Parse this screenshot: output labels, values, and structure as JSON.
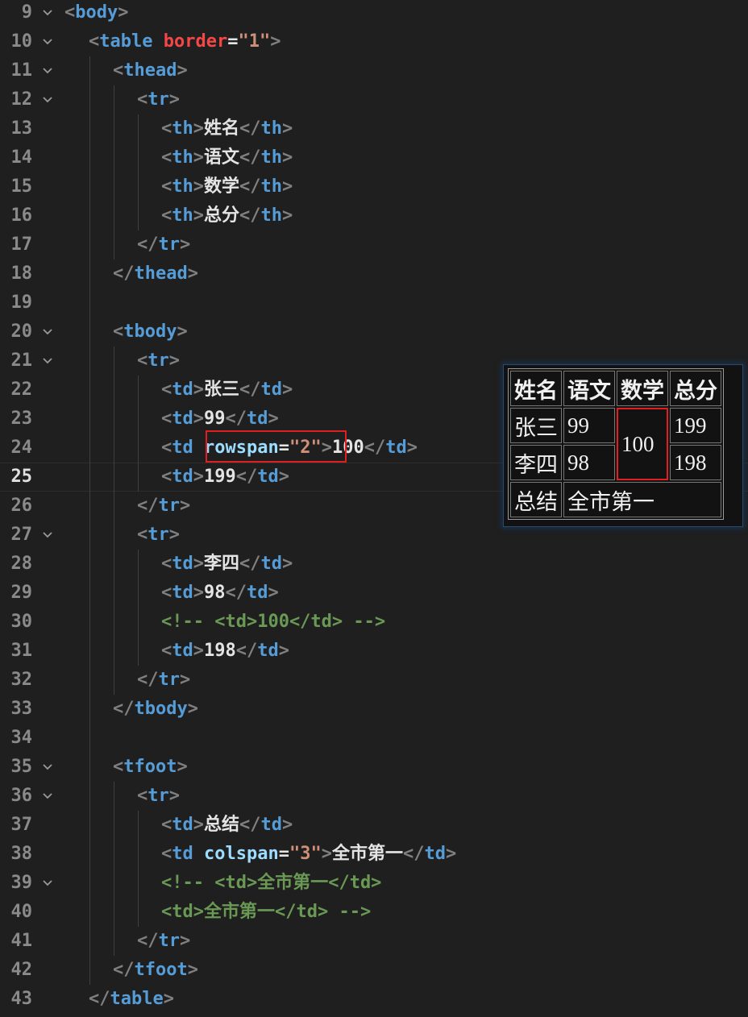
{
  "editor": {
    "lines": [
      {
        "n": "9",
        "fold": true,
        "indent": 0,
        "segs": [
          [
            "br",
            "<"
          ],
          [
            "tag",
            "body"
          ],
          [
            "br",
            ">"
          ]
        ]
      },
      {
        "n": "10",
        "fold": true,
        "indent": 1,
        "segs": [
          [
            "br",
            "<"
          ],
          [
            "tag",
            "table"
          ],
          [
            "txt",
            " "
          ],
          [
            "attrb",
            "border"
          ],
          [
            "txt",
            "="
          ],
          [
            "str",
            "\"1\""
          ],
          [
            "br",
            ">"
          ]
        ]
      },
      {
        "n": "11",
        "fold": true,
        "indent": 2,
        "segs": [
          [
            "br",
            "<"
          ],
          [
            "tag",
            "thead"
          ],
          [
            "br",
            ">"
          ]
        ]
      },
      {
        "n": "12",
        "fold": true,
        "indent": 3,
        "segs": [
          [
            "br",
            "<"
          ],
          [
            "tag",
            "tr"
          ],
          [
            "br",
            ">"
          ]
        ]
      },
      {
        "n": "13",
        "fold": false,
        "indent": 4,
        "segs": [
          [
            "br",
            "<"
          ],
          [
            "tag",
            "th"
          ],
          [
            "br",
            ">"
          ],
          [
            "txt",
            "姓名"
          ],
          [
            "br",
            "</"
          ],
          [
            "tag",
            "th"
          ],
          [
            "br",
            ">"
          ]
        ]
      },
      {
        "n": "14",
        "fold": false,
        "indent": 4,
        "segs": [
          [
            "br",
            "<"
          ],
          [
            "tag",
            "th"
          ],
          [
            "br",
            ">"
          ],
          [
            "txt",
            "语文"
          ],
          [
            "br",
            "</"
          ],
          [
            "tag",
            "th"
          ],
          [
            "br",
            ">"
          ]
        ]
      },
      {
        "n": "15",
        "fold": false,
        "indent": 4,
        "segs": [
          [
            "br",
            "<"
          ],
          [
            "tag",
            "th"
          ],
          [
            "br",
            ">"
          ],
          [
            "txt",
            "数学"
          ],
          [
            "br",
            "</"
          ],
          [
            "tag",
            "th"
          ],
          [
            "br",
            ">"
          ]
        ]
      },
      {
        "n": "16",
        "fold": false,
        "indent": 4,
        "segs": [
          [
            "br",
            "<"
          ],
          [
            "tag",
            "th"
          ],
          [
            "br",
            ">"
          ],
          [
            "txt",
            "总分"
          ],
          [
            "br",
            "</"
          ],
          [
            "tag",
            "th"
          ],
          [
            "br",
            ">"
          ]
        ]
      },
      {
        "n": "17",
        "fold": false,
        "indent": 3,
        "segs": [
          [
            "br",
            "</"
          ],
          [
            "tag",
            "tr"
          ],
          [
            "br",
            ">"
          ]
        ]
      },
      {
        "n": "18",
        "fold": false,
        "indent": 2,
        "segs": [
          [
            "br",
            "</"
          ],
          [
            "tag",
            "thead"
          ],
          [
            "br",
            ">"
          ]
        ]
      },
      {
        "n": "19",
        "fold": false,
        "indent": 2,
        "segs": []
      },
      {
        "n": "20",
        "fold": true,
        "indent": 2,
        "segs": [
          [
            "br",
            "<"
          ],
          [
            "tag",
            "tbody"
          ],
          [
            "br",
            ">"
          ]
        ]
      },
      {
        "n": "21",
        "fold": true,
        "indent": 3,
        "segs": [
          [
            "br",
            "<"
          ],
          [
            "tag",
            "tr"
          ],
          [
            "br",
            ">"
          ]
        ]
      },
      {
        "n": "22",
        "fold": false,
        "indent": 4,
        "segs": [
          [
            "br",
            "<"
          ],
          [
            "tag",
            "td"
          ],
          [
            "br",
            ">"
          ],
          [
            "txt",
            "张三"
          ],
          [
            "br",
            "</"
          ],
          [
            "tag",
            "td"
          ],
          [
            "br",
            ">"
          ]
        ]
      },
      {
        "n": "23",
        "fold": false,
        "indent": 4,
        "segs": [
          [
            "br",
            "<"
          ],
          [
            "tag",
            "td"
          ],
          [
            "br",
            ">"
          ],
          [
            "txt",
            "99"
          ],
          [
            "br",
            "</"
          ],
          [
            "tag",
            "td"
          ],
          [
            "br",
            ">"
          ]
        ]
      },
      {
        "n": "24",
        "fold": false,
        "indent": 4,
        "segs": [
          [
            "br",
            "<"
          ],
          [
            "tag",
            "td"
          ],
          [
            "txt",
            " "
          ],
          [
            "attr",
            "rowspan"
          ],
          [
            "txt",
            "="
          ],
          [
            "str",
            "\"2\""
          ],
          [
            "br",
            ">"
          ],
          [
            "txt",
            "100"
          ],
          [
            "br",
            "</"
          ],
          [
            "tag",
            "td"
          ],
          [
            "br",
            ">"
          ]
        ]
      },
      {
        "n": "25",
        "fold": false,
        "indent": 4,
        "active": true,
        "segs": [
          [
            "br",
            "<"
          ],
          [
            "tag",
            "td"
          ],
          [
            "br",
            ">"
          ],
          [
            "txt",
            "199"
          ],
          [
            "br",
            "</"
          ],
          [
            "tag",
            "td"
          ],
          [
            "br",
            ">"
          ]
        ]
      },
      {
        "n": "26",
        "fold": false,
        "indent": 3,
        "segs": [
          [
            "br",
            "</"
          ],
          [
            "tag",
            "tr"
          ],
          [
            "br",
            ">"
          ]
        ]
      },
      {
        "n": "27",
        "fold": true,
        "indent": 3,
        "segs": [
          [
            "br",
            "<"
          ],
          [
            "tag",
            "tr"
          ],
          [
            "br",
            ">"
          ]
        ]
      },
      {
        "n": "28",
        "fold": false,
        "indent": 4,
        "segs": [
          [
            "br",
            "<"
          ],
          [
            "tag",
            "td"
          ],
          [
            "br",
            ">"
          ],
          [
            "txt",
            "李四"
          ],
          [
            "br",
            "</"
          ],
          [
            "tag",
            "td"
          ],
          [
            "br",
            ">"
          ]
        ]
      },
      {
        "n": "29",
        "fold": false,
        "indent": 4,
        "segs": [
          [
            "br",
            "<"
          ],
          [
            "tag",
            "td"
          ],
          [
            "br",
            ">"
          ],
          [
            "txt",
            "98"
          ],
          [
            "br",
            "</"
          ],
          [
            "tag",
            "td"
          ],
          [
            "br",
            ">"
          ]
        ]
      },
      {
        "n": "30",
        "fold": false,
        "indent": 4,
        "segs": [
          [
            "com",
            "<!-- <td>100</td> -->"
          ]
        ]
      },
      {
        "n": "31",
        "fold": false,
        "indent": 4,
        "segs": [
          [
            "br",
            "<"
          ],
          [
            "tag",
            "td"
          ],
          [
            "br",
            ">"
          ],
          [
            "txt",
            "198"
          ],
          [
            "br",
            "</"
          ],
          [
            "tag",
            "td"
          ],
          [
            "br",
            ">"
          ]
        ]
      },
      {
        "n": "32",
        "fold": false,
        "indent": 3,
        "segs": [
          [
            "br",
            "</"
          ],
          [
            "tag",
            "tr"
          ],
          [
            "br",
            ">"
          ]
        ]
      },
      {
        "n": "33",
        "fold": false,
        "indent": 2,
        "segs": [
          [
            "br",
            "</"
          ],
          [
            "tag",
            "tbody"
          ],
          [
            "br",
            ">"
          ]
        ]
      },
      {
        "n": "34",
        "fold": false,
        "indent": 2,
        "segs": []
      },
      {
        "n": "35",
        "fold": true,
        "indent": 2,
        "segs": [
          [
            "br",
            "<"
          ],
          [
            "tag",
            "tfoot"
          ],
          [
            "br",
            ">"
          ]
        ]
      },
      {
        "n": "36",
        "fold": true,
        "indent": 3,
        "segs": [
          [
            "br",
            "<"
          ],
          [
            "tag",
            "tr"
          ],
          [
            "br",
            ">"
          ]
        ]
      },
      {
        "n": "37",
        "fold": false,
        "indent": 4,
        "segs": [
          [
            "br",
            "<"
          ],
          [
            "tag",
            "td"
          ],
          [
            "br",
            ">"
          ],
          [
            "txt",
            "总结"
          ],
          [
            "br",
            "</"
          ],
          [
            "tag",
            "td"
          ],
          [
            "br",
            ">"
          ]
        ]
      },
      {
        "n": "38",
        "fold": false,
        "indent": 4,
        "segs": [
          [
            "br",
            "<"
          ],
          [
            "tag",
            "td"
          ],
          [
            "txt",
            " "
          ],
          [
            "attr",
            "colspan"
          ],
          [
            "txt",
            "="
          ],
          [
            "str",
            "\"3\""
          ],
          [
            "br",
            ">"
          ],
          [
            "txt",
            "全市第一"
          ],
          [
            "br",
            "</"
          ],
          [
            "tag",
            "td"
          ],
          [
            "br",
            ">"
          ]
        ]
      },
      {
        "n": "39",
        "fold": true,
        "indent": 4,
        "segs": [
          [
            "com",
            "<!-- <td>全市第一</td>"
          ]
        ]
      },
      {
        "n": "40",
        "fold": false,
        "indent": 4,
        "segs": [
          [
            "com",
            "<td>全市第一</td> -->"
          ]
        ]
      },
      {
        "n": "41",
        "fold": false,
        "indent": 3,
        "segs": [
          [
            "br",
            "</"
          ],
          [
            "tag",
            "tr"
          ],
          [
            "br",
            ">"
          ]
        ]
      },
      {
        "n": "42",
        "fold": false,
        "indent": 2,
        "segs": [
          [
            "br",
            "</"
          ],
          [
            "tag",
            "tfoot"
          ],
          [
            "br",
            ">"
          ]
        ]
      },
      {
        "n": "43",
        "fold": false,
        "indent": 1,
        "segs": [
          [
            "br",
            "</"
          ],
          [
            "tag",
            "table"
          ],
          [
            "br",
            ">"
          ]
        ]
      }
    ]
  },
  "preview": {
    "headers": [
      "姓名",
      "语文",
      "数学",
      "总分"
    ],
    "row1": {
      "name": "张三",
      "chinese": "99",
      "math": "100",
      "total": "199"
    },
    "row2": {
      "name": "李四",
      "chinese": "98",
      "total": "198"
    },
    "footer": {
      "label": "总结",
      "value": "全市第一"
    }
  },
  "colors": {
    "background": "#1f1f1f",
    "tag": "#569cd6",
    "attribute": "#9cdcfe",
    "string": "#ce9178",
    "comment": "#6a9955",
    "highlight": "#e02020"
  }
}
